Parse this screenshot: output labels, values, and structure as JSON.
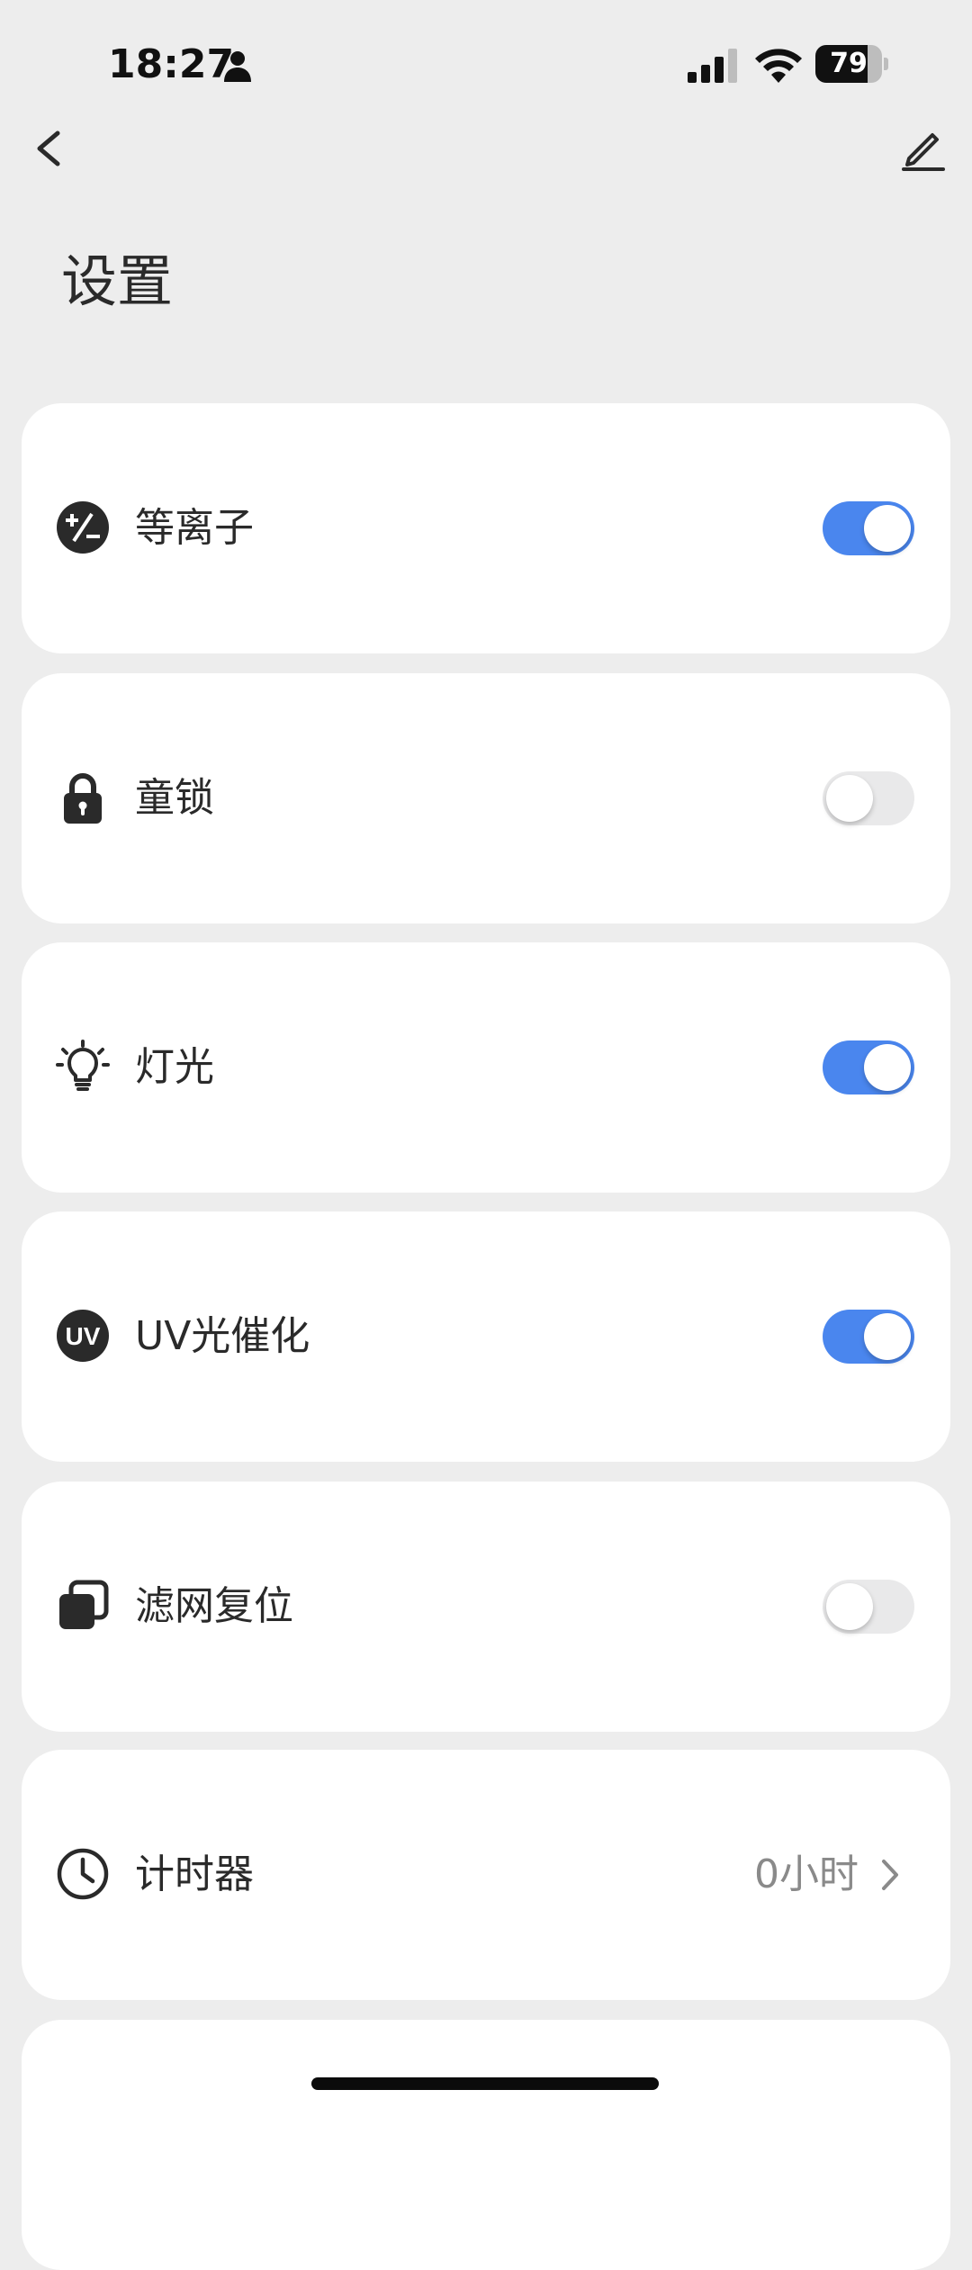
{
  "status_bar": {
    "time": "18:27",
    "battery_percent": "79",
    "battery_level": 0.79
  },
  "header": {
    "title": "设置",
    "back_icon": "chevron-left-icon",
    "edit_icon": "pencil-icon"
  },
  "settings": [
    {
      "label": "等离子",
      "icon": "plus-minus-icon",
      "type": "toggle",
      "on": true
    },
    {
      "label": "童锁",
      "icon": "lock-icon",
      "type": "toggle",
      "on": false
    },
    {
      "label": "灯光",
      "icon": "lightbulb-icon",
      "type": "toggle",
      "on": true
    },
    {
      "label": "UV光催化",
      "icon": "uv-icon",
      "icon_text": "UV",
      "type": "toggle",
      "on": true
    },
    {
      "label": "滤网复位",
      "icon": "filter-reset-icon",
      "type": "toggle",
      "on": false
    },
    {
      "label": "计时器",
      "icon": "clock-icon",
      "type": "link",
      "value": "0小时"
    }
  ],
  "colors": {
    "background": "#ededed",
    "card": "#ffffff",
    "toggle_on": "#4a86ee",
    "toggle_off": "#e9e9ea"
  }
}
